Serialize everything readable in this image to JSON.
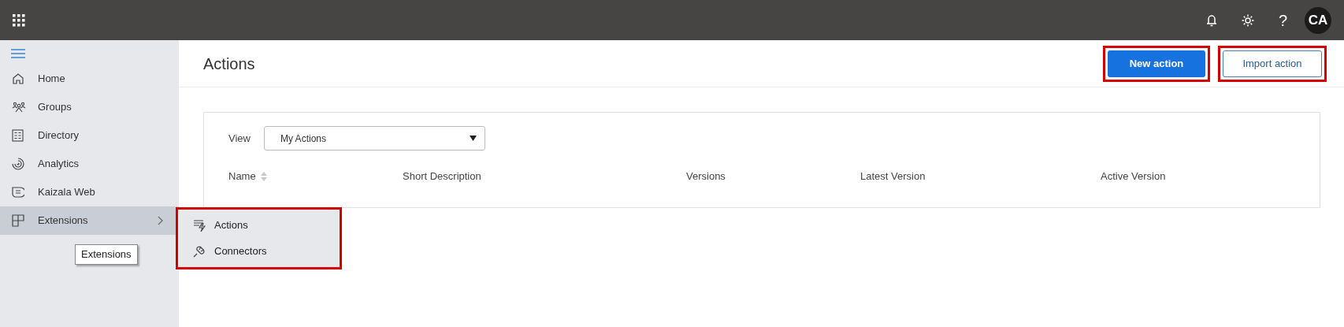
{
  "top_bar": {
    "help": "?",
    "avatar": "CA"
  },
  "sidebar": {
    "items": [
      {
        "label": "Home",
        "selected": false
      },
      {
        "label": "Groups",
        "selected": false
      },
      {
        "label": "Directory",
        "selected": false
      },
      {
        "label": "Analytics",
        "selected": false
      },
      {
        "label": "Kaizala Web",
        "selected": false
      },
      {
        "label": "Extensions",
        "selected": true,
        "expanded": true,
        "highlighted": true,
        "children": [
          {
            "label": "Actions"
          },
          {
            "label": "Connectors"
          }
        ]
      }
    ]
  },
  "tooltip": "Extensions",
  "page": {
    "title": "Actions",
    "buttons": [
      {
        "label": "New action",
        "kind": "primary",
        "highlighted": true
      },
      {
        "label": "Import action",
        "kind": "secondary",
        "highlighted": true
      }
    ]
  },
  "view": {
    "label": "View",
    "value": "My Actions"
  },
  "table": {
    "columns": [
      {
        "label": "Name",
        "sortable": true
      },
      {
        "label": "Short Description",
        "sortable": false
      },
      {
        "label": "Versions",
        "sortable": false
      },
      {
        "label": "Latest Version",
        "sortable": false
      },
      {
        "label": "Active Version",
        "sortable": false
      }
    ]
  }
}
